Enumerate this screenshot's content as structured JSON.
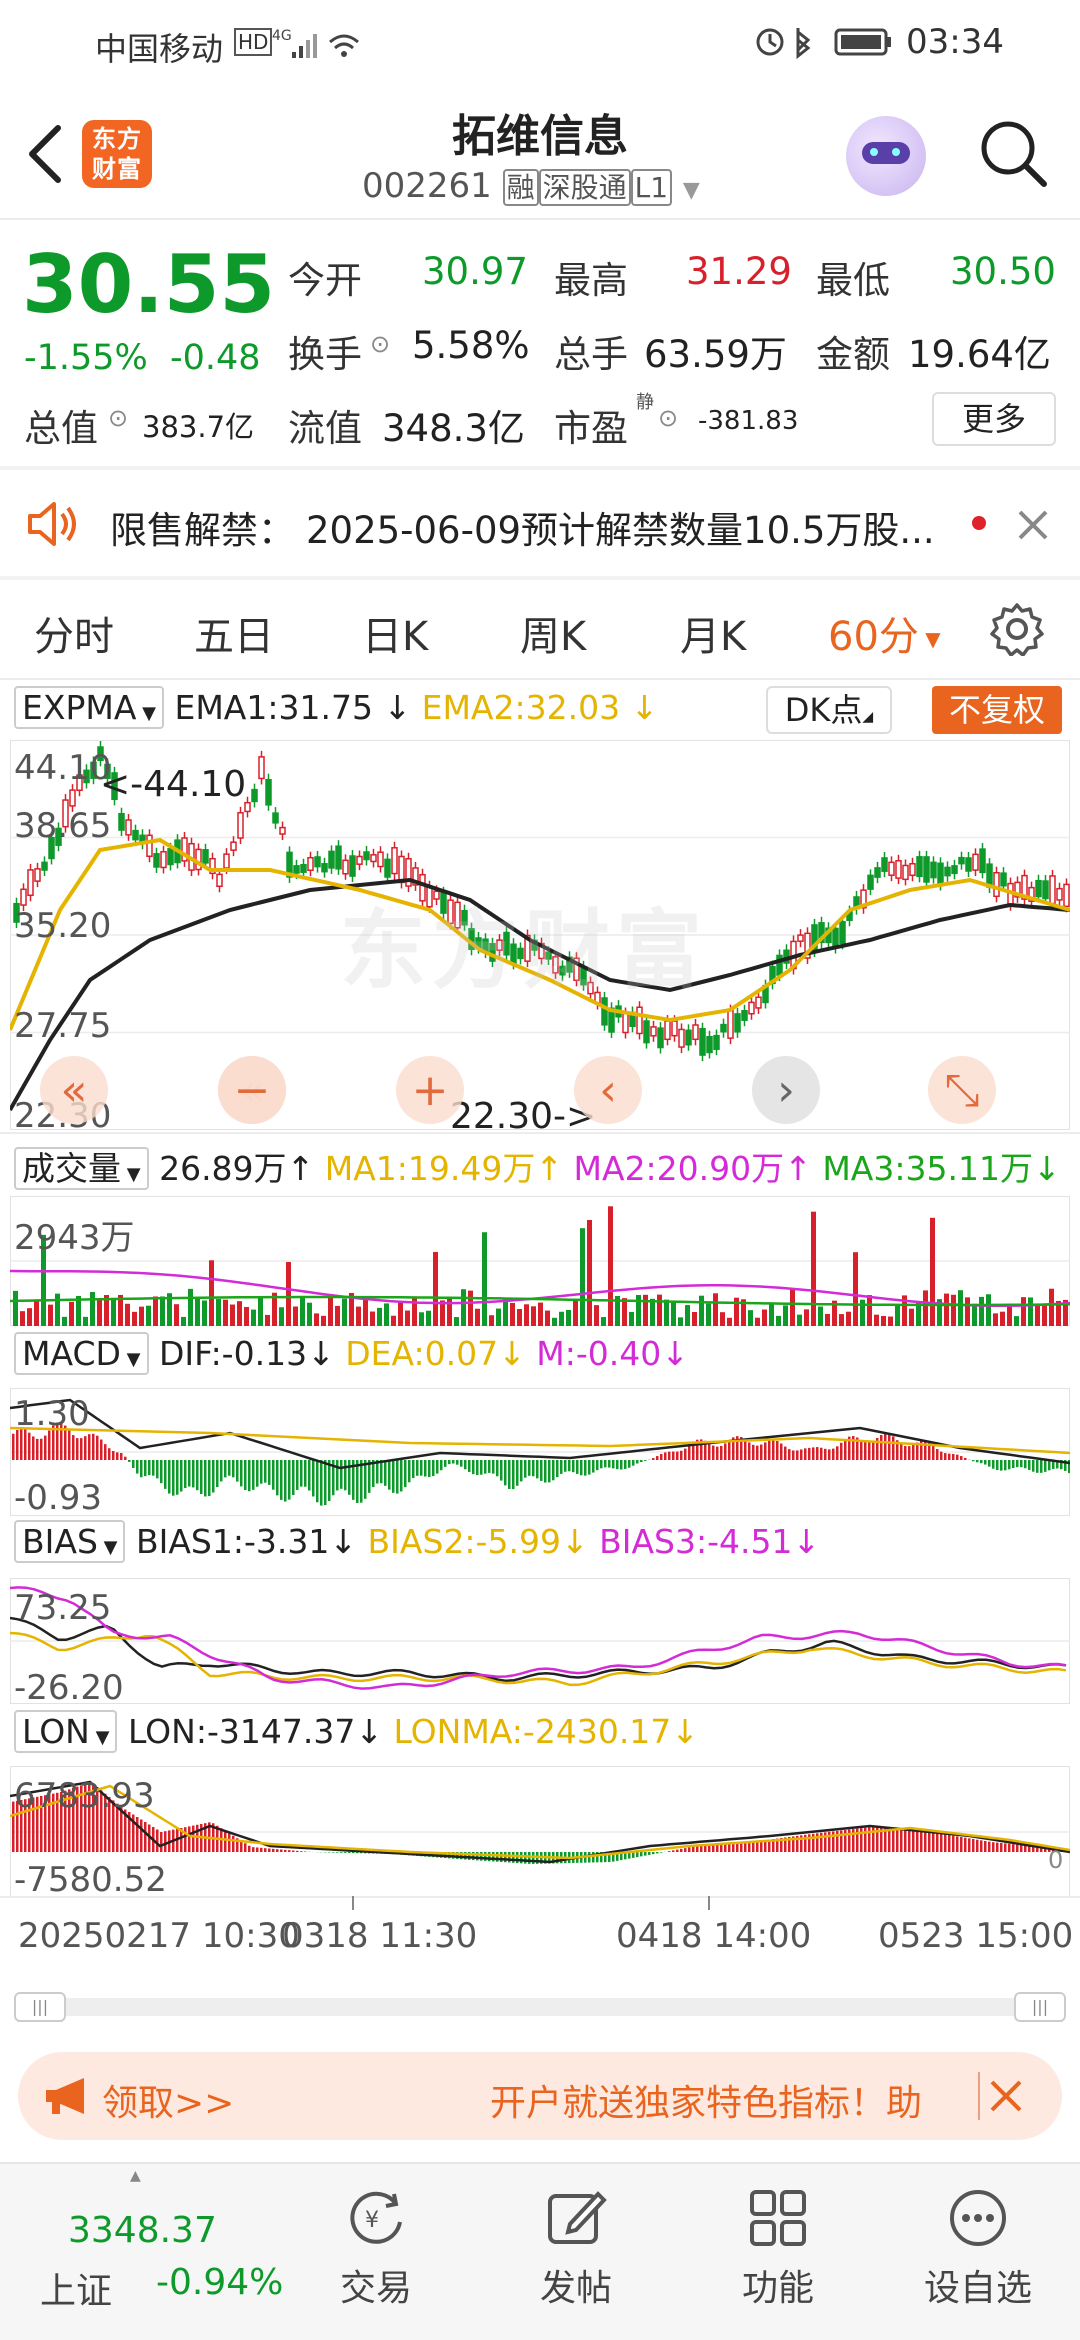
{
  "status_bar": {
    "carrier": "中国移动",
    "network": "HD 4G",
    "time": "03:34"
  },
  "header": {
    "logo_text": "东方财富",
    "title": "拓维信息",
    "code": "002261",
    "tags": [
      "融",
      "深股通",
      "L1"
    ]
  },
  "quote": {
    "price": "30.55",
    "change_pct": "-1.55%",
    "change": "-0.48",
    "open_label": "今开",
    "open": "30.97",
    "high_label": "最高",
    "high": "31.29",
    "low_label": "最低",
    "low": "30.50",
    "turnover_label": "换手",
    "turnover": "5.58%",
    "volume_label": "总手",
    "volume": "63.59万",
    "amount_label": "金额",
    "amount": "19.64亿",
    "mcap_label": "总值",
    "mcap": "383.7亿",
    "float_label": "流值",
    "float": "348.3亿",
    "pe_label": "市盈",
    "pe_sup": "静",
    "pe": "-381.83",
    "more_button": "更多"
  },
  "notice": {
    "label": "限售解禁：",
    "text": "2025-06-09预计解禁数量10.5万股..."
  },
  "tabs": [
    "分时",
    "五日",
    "日K",
    "周K",
    "月K",
    "60分"
  ],
  "main_indicator": {
    "name": "EXPMA",
    "ema1": "EMA1:31.75",
    "ema2": "EMA2:32.03",
    "dk_button": "DK点",
    "adjust_button": "不复权",
    "y_labels": [
      "44.10",
      "38.65",
      "35.20",
      "27.75",
      "22.30"
    ],
    "high_mark": "<-44.10",
    "low_mark": "22.30->",
    "watermark": "东方财富"
  },
  "volume_indicator": {
    "name": "成交量",
    "value": "26.89万",
    "ma1": "MA1:19.49万",
    "ma2": "MA2:20.90万",
    "ma3": "MA3:35.11万",
    "y_label": "2943万"
  },
  "macd_indicator": {
    "name": "MACD",
    "dif": "DIF:-0.13",
    "dea": "DEA:0.07",
    "m": "M:-0.40",
    "y_top": "1.30",
    "y_bottom": "-0.93"
  },
  "bias_indicator": {
    "name": "BIAS",
    "bias1": "BIAS1:-3.31",
    "bias2": "BIAS2:-5.99",
    "bias3": "BIAS3:-4.51",
    "y_top": "73.25",
    "y_bottom": "-26.20"
  },
  "lon_indicator": {
    "name": "LON",
    "lon": "LON:-3147.37",
    "lonma": "LONMA:-2430.17",
    "y_top": "6783.93",
    "y_bottom": "-7580.52",
    "zero": "0"
  },
  "x_axis": {
    "left": "20250217 10:30",
    "mid1": "0318 11:30",
    "mid2": "0418 14:00",
    "right": "0523 15:00"
  },
  "ad_banner": {
    "left": "领取>>",
    "text": "开户就送独家特色指标！助"
  },
  "bottom_nav": {
    "index_value": "3348.37",
    "index_name": "上证",
    "index_change": "-0.94%",
    "trade": "交易",
    "post": "发帖",
    "function": "功能",
    "watch": "设自选"
  },
  "colors": {
    "up": "#d8202a",
    "down": "#0e9a2b",
    "ema1": "#222222",
    "ema2": "#e4b400",
    "accent": "#e8641f"
  }
}
